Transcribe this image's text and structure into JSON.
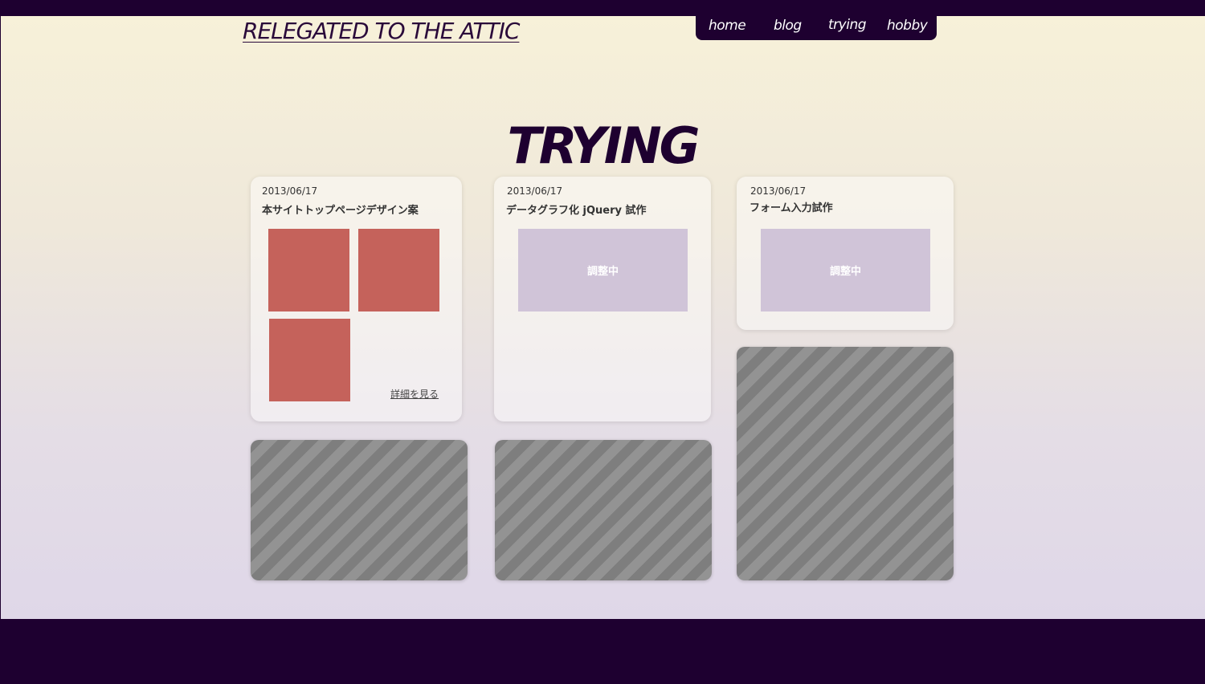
{
  "site": {
    "title": "RELEGATED TO THE ATTIC"
  },
  "nav": {
    "items": [
      {
        "label": "home"
      },
      {
        "label": "blog"
      },
      {
        "label": "trying"
      },
      {
        "label": "hobby"
      }
    ]
  },
  "page": {
    "heading": "TRYING"
  },
  "cards": [
    {
      "date": "2013/06/17",
      "title": "本サイトトップページデザイン案",
      "link": "詳細を見る"
    },
    {
      "date": "2013/06/17",
      "title": "データグラフ化 jQuery 試作",
      "status": "調整中"
    },
    {
      "date": "2013/06/17",
      "title": "フォーム入力試作",
      "status": "調整中"
    }
  ],
  "colors": {
    "dark_purple": "#1e0030",
    "thumbnail": "#c5625b",
    "placeholder": "#d0c4d8",
    "stripe_dark": "#7e7e7e",
    "stripe_light": "#939393"
  }
}
